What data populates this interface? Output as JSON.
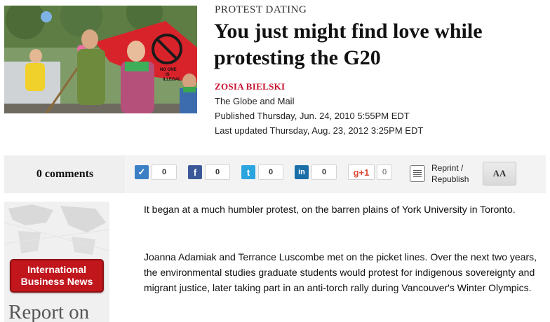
{
  "article": {
    "kicker": "PROTEST DATING",
    "headline": "You just might find love while protesting the G20",
    "byline": "ZOSIA BIELSKI",
    "source": "The Globe and Mail",
    "published": "Published Thursday, Jun. 24, 2010 5:55PM EDT",
    "updated": "Last updated Thursday, Aug. 23, 2012 3:25PM EDT",
    "paragraphs": [
      "It began at a much humbler protest, on the barren plains of York University in Toronto.",
      "Joanna Adamiak and Terrance Luscombe met on the picket lines. Over the next two years, the environmental studies graduate students would protest for indigenous sovereignty and migrant justice, later taking part in an anti-torch rally during Vancouver's Winter Olympics."
    ]
  },
  "photo": {
    "flag_text_lines": [
      "NO ONE",
      "IS",
      "ILLEGAL"
    ]
  },
  "share_bar": {
    "comments_label": "0 comments",
    "services": [
      {
        "name": "vote",
        "icon": "checkmark-icon",
        "glyph": "✓",
        "color": "#3b7fc4",
        "count": "0"
      },
      {
        "name": "facebook",
        "icon": "facebook-icon",
        "glyph": "f",
        "color": "#3b5998",
        "count": "0"
      },
      {
        "name": "twitter",
        "icon": "twitter-icon",
        "glyph": "t",
        "color": "#2ba5e0",
        "count": "0"
      },
      {
        "name": "linkedin",
        "icon": "linkedin-icon",
        "glyph": "in",
        "color": "#1b6fa8",
        "count": "0"
      }
    ],
    "google_plus": {
      "label": "g+1",
      "count": "0",
      "color": "#dd4b39"
    },
    "reprint_label_line1": "Reprint /",
    "reprint_label_line2": "Republish",
    "font_size_label": "AA"
  },
  "ad": {
    "badge_line1": "International",
    "badge_line2": "Business News",
    "tagline": "Report on",
    "badge_color": "#c0161c"
  },
  "colors": {
    "byline_red": "#c8102e",
    "sharebar_bg": "#f3f3f3"
  }
}
